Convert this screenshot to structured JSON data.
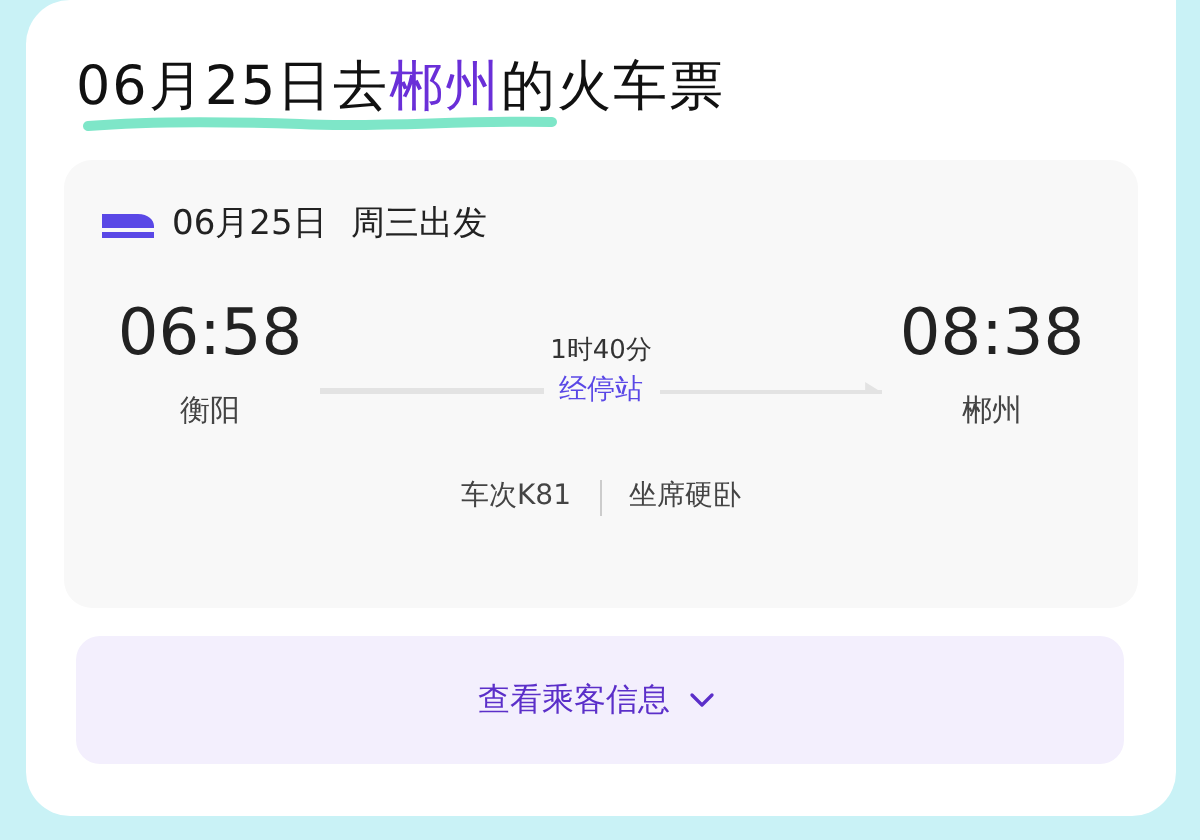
{
  "title_parts": [
    {
      "text": "06月25日去",
      "highlight": false
    },
    {
      "text": "郴州",
      "highlight": true
    },
    {
      "text": "的火车票",
      "highlight": false
    }
  ],
  "trip": {
    "date": "06月25日",
    "weekday": "周三出发",
    "depart": {
      "time": "06:58",
      "station": "衡阳"
    },
    "duration": "1时40分",
    "via_link": "经停站",
    "arrive": {
      "time": "08:38",
      "station": "郴州"
    },
    "train": "车次K81",
    "seat": "坐席硬卧"
  },
  "passenger_button": "查看乘客信息"
}
